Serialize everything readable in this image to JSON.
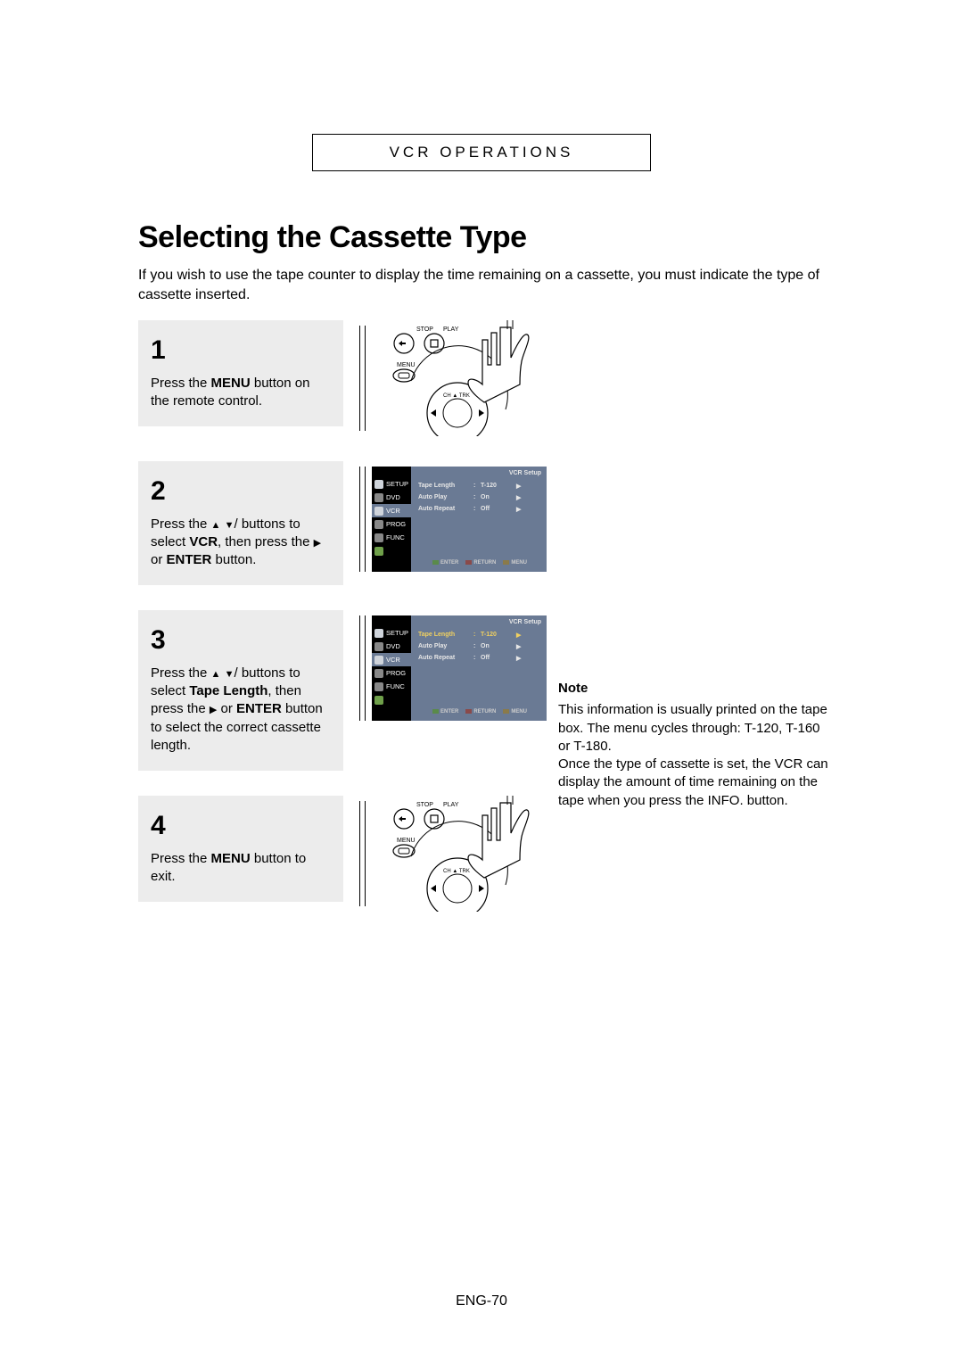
{
  "section_header": "VCR OPERATIONS",
  "title": "Selecting the Cassette Type",
  "intro": "If you wish to use the tape counter to display the time remaining on a cassette, you must indicate the type of cassette inserted.",
  "steps": {
    "s1": {
      "num": "1",
      "line1": "Press the ",
      "menu": "MENU",
      "line2": " button on the remote control."
    },
    "s2": {
      "num": "2",
      "line1": "Press the ",
      "line2": " buttons to select ",
      "vcr": "VCR",
      "line3": ", then press the ",
      "enter": "ENTER",
      "line4": " or ",
      "line5": " button."
    },
    "s3": {
      "num": "3",
      "line1": "Press the ",
      "line2": " buttons to select ",
      "tapelen": "Tape Length",
      "line3": ", then press the ",
      "enter": "ENTER",
      "line4": " or ",
      "line5": " button to select the correct cassette length."
    },
    "s4": {
      "num": "4",
      "line1": "Press the ",
      "menu": "MENU",
      "line2": " button to exit."
    }
  },
  "remote": {
    "stop": "STOP",
    "play": "PLAY",
    "menu": "MENU",
    "chtrk": "CH ▲ TRK"
  },
  "osd": {
    "title": "VCR Setup",
    "side": [
      "SETUP",
      "DVD",
      "VCR",
      "PROG",
      "FUNC"
    ],
    "rows": [
      {
        "label": "Tape Length",
        "val": "T-120"
      },
      {
        "label": "Auto Play",
        "val": "On"
      },
      {
        "label": "Auto Repeat",
        "val": "Off"
      }
    ],
    "footer": [
      "ENTER",
      "RETURN",
      "MENU"
    ]
  },
  "note": {
    "heading": "Note",
    "p1": "This information is usually printed on the tape box. The menu cycles through: T-120, T-160 or T-180.",
    "p2": "Once the type of cassette is set, the VCR can display the amount of time remaining on the tape when you press the INFO. button."
  },
  "page_footer": "ENG-70"
}
